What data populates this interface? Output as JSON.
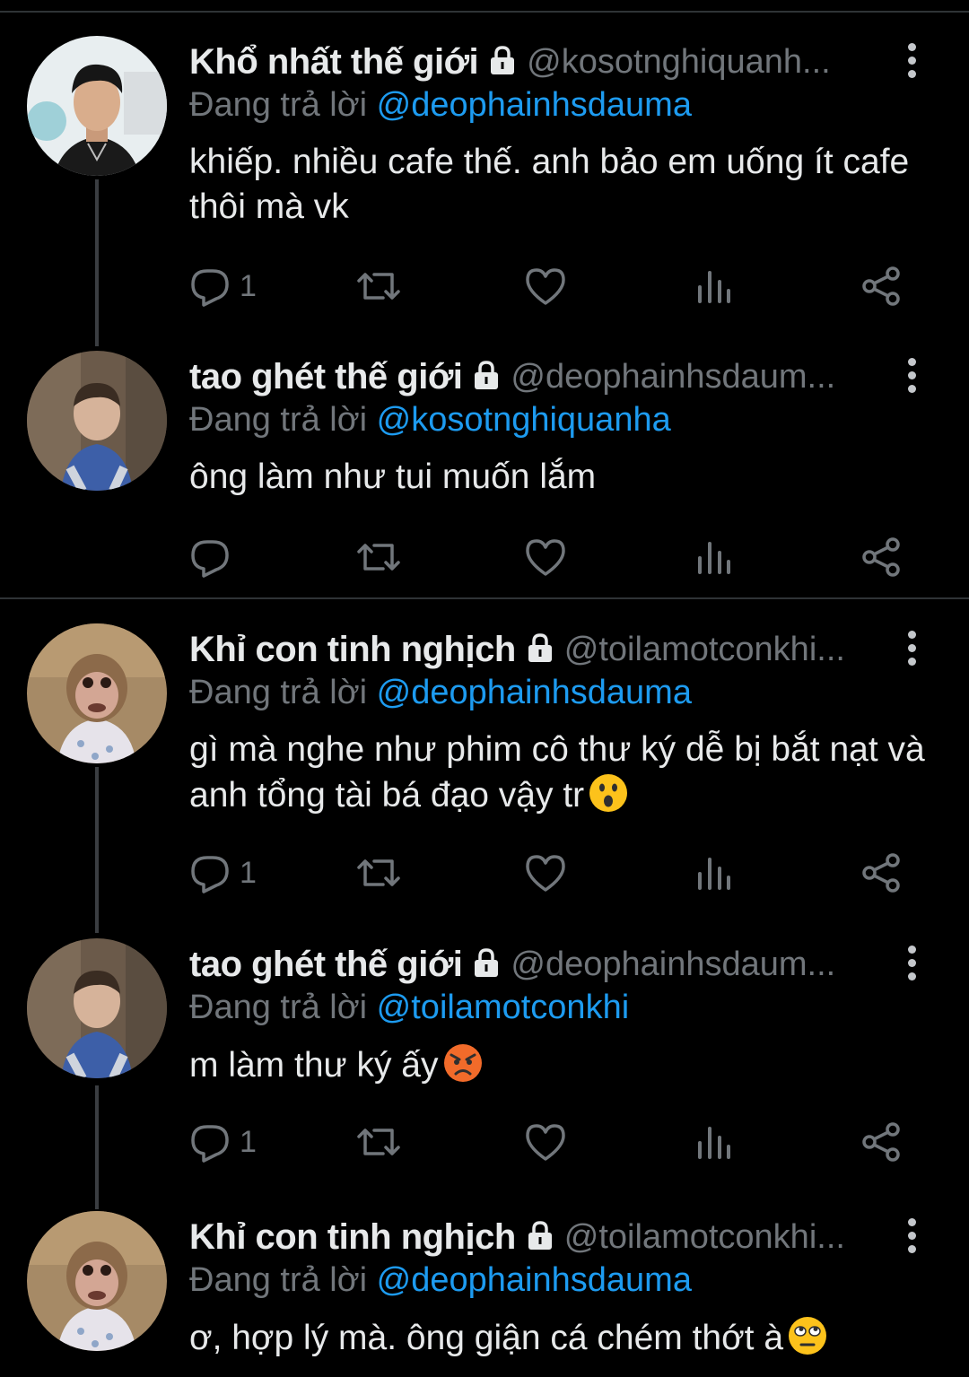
{
  "tweets": [
    {
      "name": "Khổ nhất thế giới",
      "handle": "@kosotnghiquanh...",
      "replying_label": "Đang trả lời",
      "replying_to": "@deophainhsdauma",
      "text": "khiếp. nhiều cafe thế. anh bảo em uống ít cafe thôi mà vk",
      "emoji": "",
      "reply_count": "1",
      "avatar": "young-man-avatar"
    },
    {
      "name": "tao ghét thế giới",
      "handle": "@deophainhsdaum...",
      "replying_label": "Đang trả lời",
      "replying_to": "@kosotnghiquanha",
      "text": "ông làm như tui muốn lắm",
      "emoji": "",
      "reply_count": "",
      "avatar": "child-avatar"
    },
    {
      "name": "Khỉ con tinh nghịch",
      "handle": "@toilamotconkhi...",
      "replying_label": "Đang trả lời",
      "replying_to": "@deophainhsdauma",
      "text": "gì mà nghe như phim cô thư ký dễ bị bắt nạt và anh tổng tài bá đạo vậy tr",
      "emoji": "astonished-face",
      "reply_count": "1",
      "avatar": "monkey-avatar"
    },
    {
      "name": "tao ghét thế giới",
      "handle": "@deophainhsdaum...",
      "replying_label": "Đang trả lời",
      "replying_to": "@toilamotconkhi",
      "text": "m làm thư ký ấy",
      "emoji": "angry-face",
      "reply_count": "1",
      "avatar": "child-avatar"
    },
    {
      "name": "Khỉ con tinh nghịch",
      "handle": "@toilamotconkhi...",
      "replying_label": "Đang trả lời",
      "replying_to": "@deophainhsdauma",
      "text": "ơ, hợp lý mà. ông giận cá chém thớt à",
      "emoji": "eye-roll-face",
      "reply_count": "",
      "avatar": "monkey-avatar"
    }
  ],
  "icons": {
    "reply": "reply-icon",
    "retweet": "retweet-icon",
    "like": "like-icon",
    "views": "views-icon",
    "share": "share-icon",
    "lock": "lock-icon",
    "more": "more-icon"
  },
  "colors": {
    "background": "#000000",
    "text": "#e7e9ea",
    "muted": "#71767b",
    "mention": "#1d9bf0",
    "divider": "#2f3336"
  }
}
